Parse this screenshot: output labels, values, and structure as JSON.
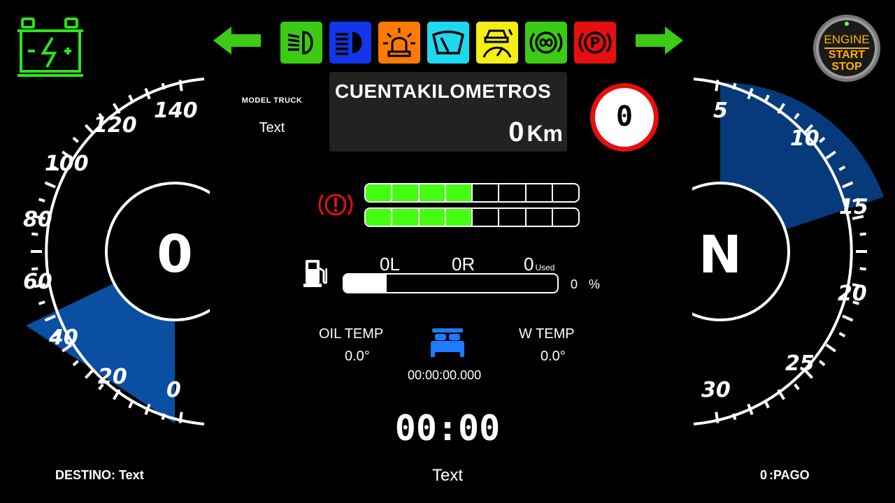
{
  "left_gauge": {
    "ticks": [
      "140",
      "120",
      "100",
      "80",
      "60",
      "40",
      "20",
      "0"
    ],
    "value": "0",
    "fill_color": "#0b4fa3"
  },
  "right_gauge": {
    "ticks": [
      "5",
      "10",
      "15",
      "20",
      "25",
      "30"
    ],
    "value": "N",
    "fill_color": "#063a7a"
  },
  "indicators": [
    {
      "name": "low-beam-icon",
      "bg": "#3ccb13"
    },
    {
      "name": "high-beam-icon",
      "bg": "#1236e8"
    },
    {
      "name": "beacon-icon",
      "bg": "#ff7a00"
    },
    {
      "name": "wiper-icon",
      "bg": "#1ed8f0"
    },
    {
      "name": "cruise-control-icon",
      "bg": "#f4ee16"
    },
    {
      "name": "retarder-icon",
      "bg": "#3ccb13"
    },
    {
      "name": "parking-brake-icon",
      "bg": "#e60f0f"
    }
  ],
  "model": {
    "label": "MODEL TRUCK",
    "text": "Text"
  },
  "odometer": {
    "title": "CUENTAKILOMETROS",
    "value": "0",
    "unit": "Km"
  },
  "speed_limit": "0",
  "air_pressure": {
    "bar1_fill": 0.5,
    "bar2_fill": 0.5
  },
  "fuel": {
    "left": "0L",
    "range": "0R",
    "used": "0",
    "used_label": "Used",
    "percent": "0",
    "percent_sign": "%",
    "fill": 0.2
  },
  "oil_temp": {
    "label": "OIL TEMP",
    "value": "0.0°"
  },
  "water_temp": {
    "label": "W TEMP",
    "value": "0.0°"
  },
  "rest_timer": "00:00:00.000",
  "clock": "00:00",
  "footer": {
    "destino_label": "DESTINO:",
    "destino_value": "Text",
    "center_text": "Text",
    "pago_value": "0",
    "pago_label": ":PAGO"
  },
  "engine_button": {
    "line1": "ENGINE",
    "line2": "START",
    "line3": "STOP"
  },
  "colors": {
    "green": "#44ff11",
    "battery": "#2be31a",
    "signal": "#3ccb13"
  }
}
